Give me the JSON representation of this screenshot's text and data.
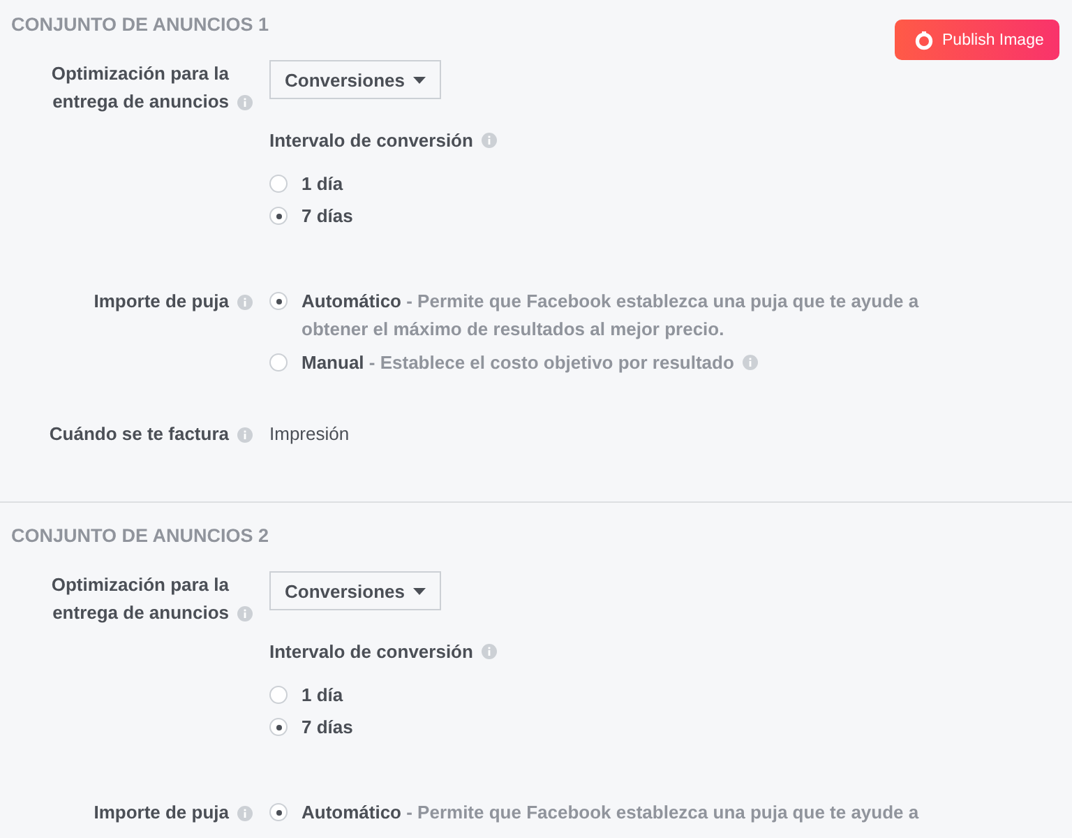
{
  "publish_button": {
    "label": "Publish Image"
  },
  "sections": [
    {
      "title": "CONJUNTO DE ANUNCIOS 1",
      "rows": [
        {
          "kind": "dropdown",
          "label": "Optimización para la entrega de anuncios",
          "value": "Conversiones",
          "interval": {
            "label": "Intervalo de conversión",
            "options": [
              {
                "label": "1 día",
                "selected": false
              },
              {
                "label": "7 días",
                "selected": true
              }
            ]
          }
        },
        {
          "kind": "radios",
          "label": "Importe de puja",
          "options": [
            {
              "text": "**Automático** - Permite que Facebook establezca una puja que te ayude a obtener el máximo de resultados al mejor precio.",
              "info": false,
              "selected": true
            },
            {
              "text": "**Manual** - Establece el costo objetivo por resultado",
              "info": true,
              "selected": false
            }
          ]
        },
        {
          "kind": "text",
          "label": "Cuándo se te factura",
          "value": "Impresión"
        }
      ]
    },
    {
      "title": "CONJUNTO DE ANUNCIOS 2",
      "rows": [
        {
          "kind": "dropdown",
          "label": "Optimización para la entrega de anuncios",
          "value": "Conversiones",
          "interval": {
            "label": "Intervalo de conversión",
            "options": [
              {
                "label": "1 día",
                "selected": false
              },
              {
                "label": "7 días",
                "selected": true
              }
            ]
          }
        },
        {
          "kind": "radios",
          "label": "Importe de puja",
          "options": [
            {
              "text": "**Automático** - Permite que Facebook establezca una puja que te ayude a",
              "info": false,
              "selected": true
            }
          ]
        }
      ]
    }
  ]
}
